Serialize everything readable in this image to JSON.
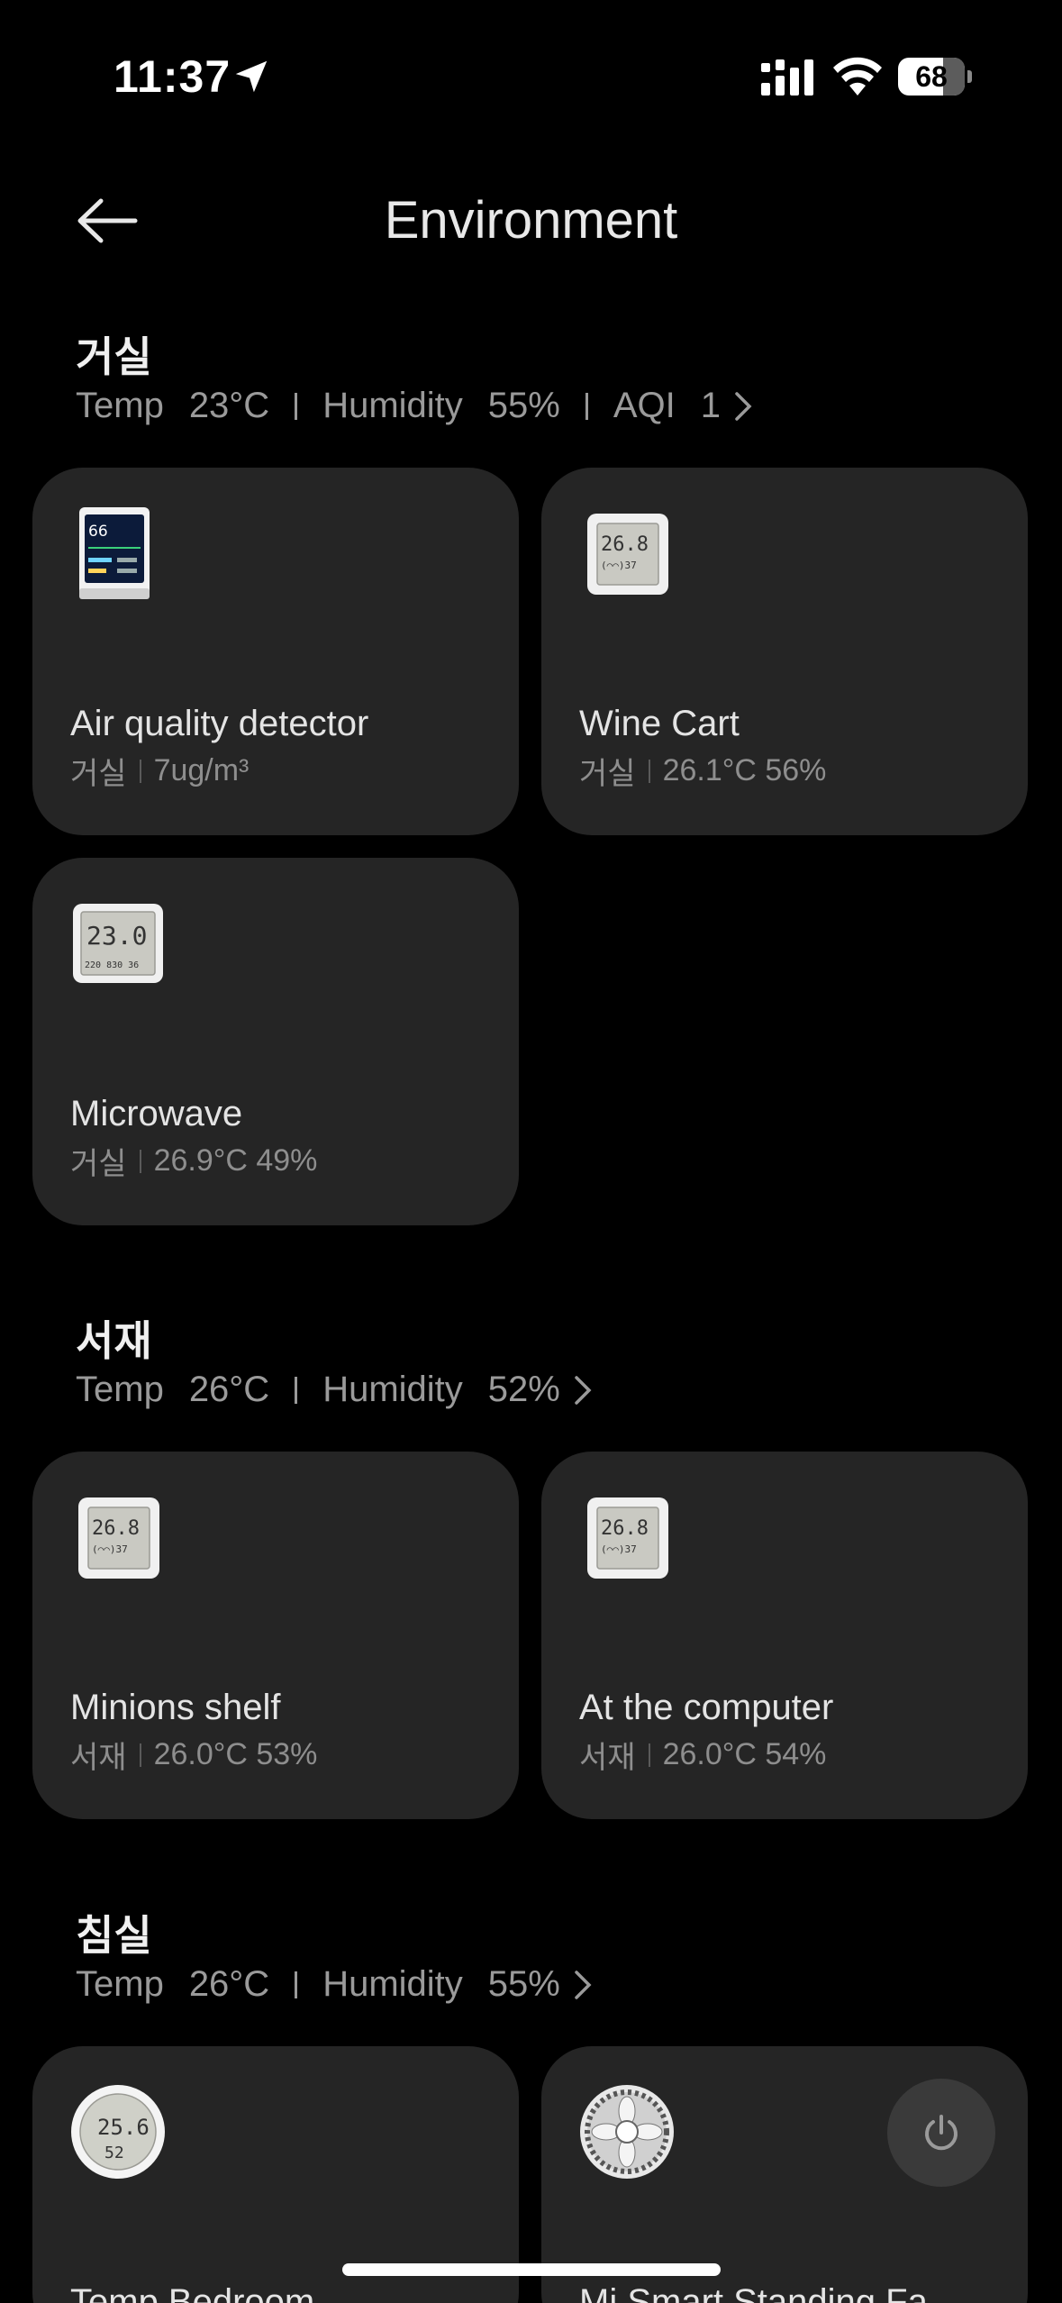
{
  "status_bar": {
    "time": "11:37",
    "battery": "68",
    "battery_level": 0.68
  },
  "header": {
    "title": "Environment"
  },
  "rooms": [
    {
      "name": "거실",
      "stats": [
        {
          "label": "Temp",
          "value": "23°C"
        },
        {
          "label": "Humidity",
          "value": "55%"
        },
        {
          "label": "AQI",
          "value": "1"
        }
      ],
      "devices": [
        {
          "name": "Air quality detector",
          "room": "거실",
          "reading": "7ug/m³"
        },
        {
          "name": "Wine Cart",
          "room": "거실",
          "reading": "26.1°C 56%"
        },
        {
          "name": "Microwave",
          "room": "거실",
          "reading": "26.9°C 49%"
        }
      ]
    },
    {
      "name": "서재",
      "stats": [
        {
          "label": "Temp",
          "value": "26°C"
        },
        {
          "label": "Humidity",
          "value": "52%"
        }
      ],
      "devices": [
        {
          "name": "Minions shelf",
          "room": "서재",
          "reading": "26.0°C 53%"
        },
        {
          "name": "At the computer",
          "room": "서재",
          "reading": "26.0°C 54%"
        }
      ]
    },
    {
      "name": "침실",
      "stats": [
        {
          "label": "Temp",
          "value": "26°C"
        },
        {
          "label": "Humidity",
          "value": "55%"
        }
      ],
      "devices": [
        {
          "name": "Temp Bedroom"
        },
        {
          "name": "Mi Smart Standing Fa"
        }
      ]
    }
  ],
  "device_screens": {
    "air": {
      "main": "66"
    },
    "lcd": {
      "temp": "26.8",
      "face": "(⌒⌒)37"
    },
    "lcd2": {
      "temp": "23.0",
      "sub": "220  830  36"
    },
    "round": {
      "temp": "25.6",
      "hum": "52"
    }
  },
  "colors": {
    "background": "#000000",
    "card": "#252525",
    "text_primary": "#e4e4e4",
    "text_secondary": "#8e8e8e"
  }
}
